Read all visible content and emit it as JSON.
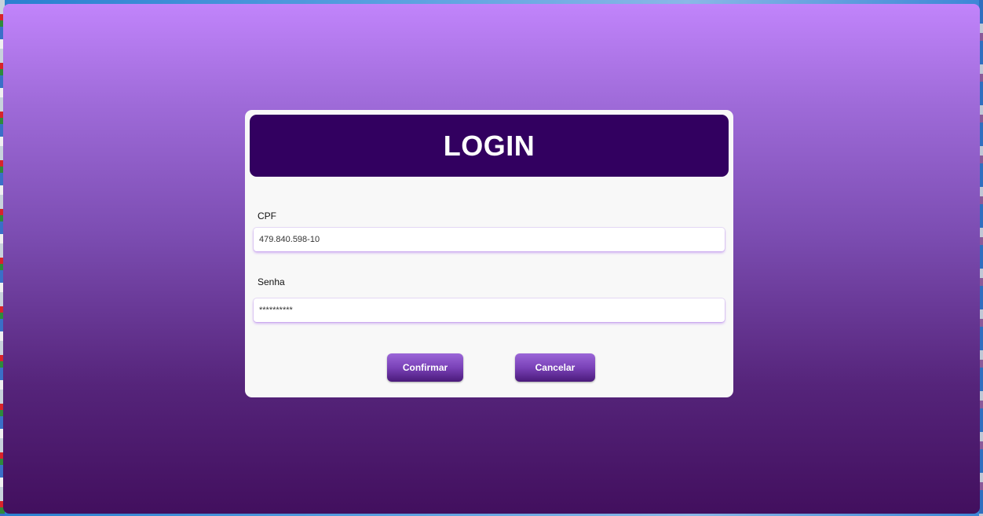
{
  "window": {
    "title": "LOGIN"
  },
  "form": {
    "cpf_label": "CPF",
    "cpf_value": "479.840.598-10",
    "senha_label": "Senha",
    "senha_value": "**********"
  },
  "buttons": {
    "confirm_label": "Confirmar",
    "cancel_label": "Cancelar"
  },
  "colors": {
    "header_bg": "#320060",
    "gradient_top": "#c184fb",
    "gradient_bottom": "#420f5e",
    "card_bg": "#f8f8f8"
  }
}
